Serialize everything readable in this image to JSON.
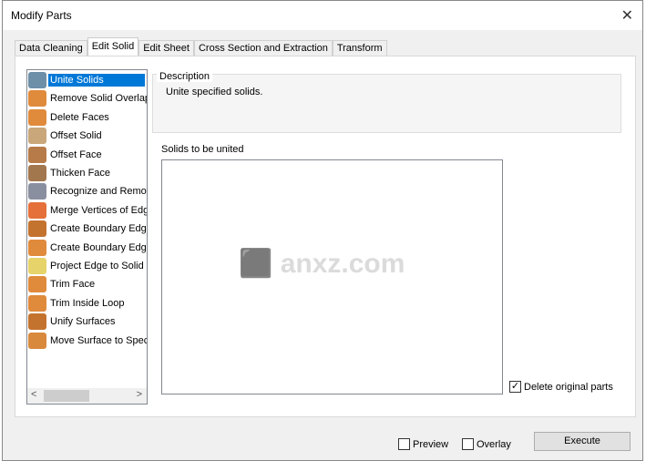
{
  "window": {
    "title": "Modify Parts",
    "close_icon": "close-icon"
  },
  "tabs": [
    {
      "label": "Data Cleaning"
    },
    {
      "label": "Edit Solid",
      "active": true
    },
    {
      "label": "Edit Sheet"
    },
    {
      "label": "Cross Section and Extraction"
    },
    {
      "label": "Transform"
    }
  ],
  "commands": [
    {
      "label": "Unite Solids",
      "icon": "unite-solids-icon",
      "color": "#6d8fa8",
      "selected": true
    },
    {
      "label": "Remove Solid Overlap",
      "icon": "remove-overlap-icon",
      "color": "#e08a3c"
    },
    {
      "label": "Delete Faces",
      "icon": "delete-faces-icon",
      "color": "#e08a3c"
    },
    {
      "label": "Offset Solid",
      "icon": "offset-solid-icon",
      "color": "#c9a77a"
    },
    {
      "label": "Offset Face",
      "icon": "offset-face-icon",
      "color": "#b77b4a"
    },
    {
      "label": "Thicken Face",
      "icon": "thicken-face-icon",
      "color": "#a3774e"
    },
    {
      "label": "Recognize and Remove",
      "icon": "recognize-remove-icon",
      "color": "#8a8fa0"
    },
    {
      "label": "Merge Vertices of Edge",
      "icon": "merge-vertices-icon",
      "color": "#e5703a"
    },
    {
      "label": "Create Boundary Edges",
      "icon": "boundary-edges-icon",
      "color": "#c4732e"
    },
    {
      "label": "Create Boundary Edges",
      "icon": "boundary-edges-icon",
      "color": "#e08a3c"
    },
    {
      "label": "Project Edge to Solid",
      "icon": "project-edge-icon",
      "color": "#e6d36a"
    },
    {
      "label": "Trim Face",
      "icon": "trim-face-icon",
      "color": "#e08a3c"
    },
    {
      "label": "Trim Inside Loop",
      "icon": "trim-loop-icon",
      "color": "#e08a3c"
    },
    {
      "label": "Unify Surfaces",
      "icon": "unify-surfaces-icon",
      "color": "#c4732e"
    },
    {
      "label": "Move Surface to Specifi",
      "icon": "move-surface-icon",
      "color": "#d9893c"
    }
  ],
  "description": {
    "heading": "Description",
    "text": "Unite specified solids."
  },
  "solids": {
    "label": "Solids to be united"
  },
  "delete_original": {
    "label": "Delete original parts",
    "checked": true
  },
  "footer": {
    "preview": "Preview",
    "overlay": "Overlay",
    "execute": "Execute"
  },
  "watermark": "anxz.com"
}
